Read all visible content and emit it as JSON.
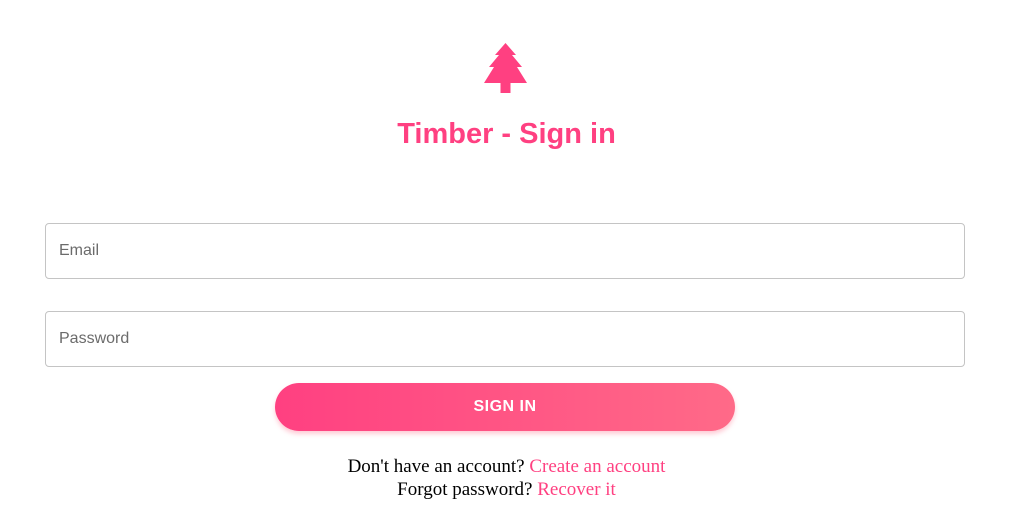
{
  "app": {
    "title": "Timber - Sign in",
    "logo_icon": "tree-icon",
    "accent_color": "#ff4081"
  },
  "form": {
    "email_placeholder": "Email",
    "password_placeholder": "Password",
    "signin_label": "SIGN IN"
  },
  "footer": {
    "signup_prompt": "Don't have an account?",
    "signup_link": "Create an account",
    "recover_prompt": "Forgot password?",
    "recover_link": "Recover it"
  }
}
